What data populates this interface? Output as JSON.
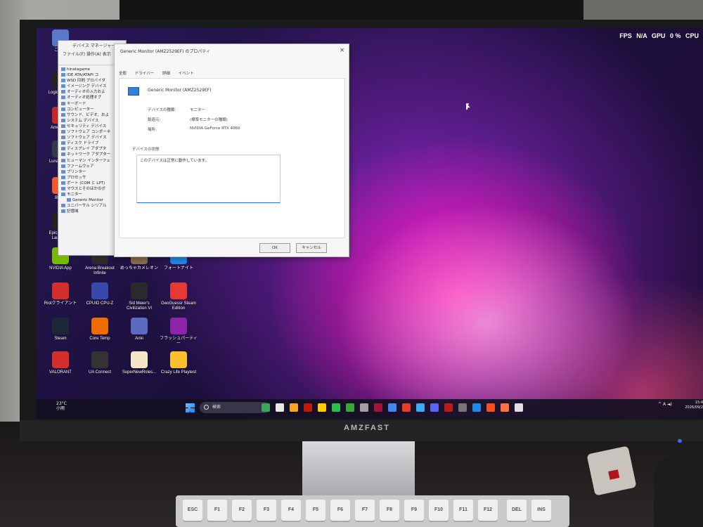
{
  "monitor": {
    "brand": "AMZFAST"
  },
  "overlay": {
    "fps_label": "FPS",
    "fps_value": "N/A",
    "gpu_label": "GPU",
    "gpu_value": "0 %",
    "cpu_label": "CPU"
  },
  "desktop_icons": [
    {
      "label": "ごみ箱",
      "icon": "recycle-bin-icon",
      "color": "#5a78c8"
    },
    {
      "label": "Logicool G H",
      "icon": "logitech-g-icon",
      "color": "#222222"
    },
    {
      "label": "Among Us",
      "icon": "among-us-icon",
      "color": "#c62828"
    },
    {
      "label": "Lunar Client",
      "icon": "lunar-client-icon",
      "color": "#333a48"
    },
    {
      "label": "Brave",
      "icon": "brave-icon",
      "color": "#f15a29"
    },
    {
      "label": "Epic Games Launcher",
      "icon": "epic-games-icon",
      "color": "#222222"
    },
    {
      "label": "NVIDIA App",
      "icon": "nvidia-icon",
      "color": "#76b900"
    },
    {
      "label": "Arena Breakout Infinite",
      "icon": "abi-icon",
      "color": "#2b2b2b"
    },
    {
      "label": "めっちゃカメレオン",
      "icon": "chameleon-icon",
      "color": "#8a6b4a"
    },
    {
      "label": "フォートナイト",
      "icon": "fortnite-icon",
      "color": "#1e88e5"
    },
    {
      "label": "Riotクライアント",
      "icon": "riot-icon",
      "color": "#d32f2f"
    },
    {
      "label": "CPUID CPU-Z",
      "icon": "cpuz-icon",
      "color": "#3949ab"
    },
    {
      "label": "Sid Meier's Civilization VI",
      "icon": "civ6-icon",
      "color": "#2a2a2a"
    },
    {
      "label": "GeoGuessr Steam Edition",
      "icon": "geoguessr-icon",
      "color": "#e53935"
    },
    {
      "label": "Steam",
      "icon": "steam-icon",
      "color": "#1b2838"
    },
    {
      "label": "Core Temp",
      "icon": "core-temp-icon",
      "color": "#ef6c00"
    },
    {
      "label": "Anki",
      "icon": "anki-icon",
      "color": "#5c6bc0"
    },
    {
      "label": "フラッシュパーティー",
      "icon": "flash-party-icon",
      "color": "#8e24aa"
    },
    {
      "label": "VALORANT",
      "icon": "valorant-icon",
      "color": "#d32f2f"
    },
    {
      "label": "UA Connect",
      "icon": "ua-connect-icon",
      "color": "#333333"
    },
    {
      "label": "SuperNewRoles...",
      "icon": "supernewroles-icon",
      "color": "#f5e6c8"
    },
    {
      "label": "Crazy Life Playtest",
      "icon": "crazy-life-icon",
      "color": "#fbc02d"
    }
  ],
  "device_manager": {
    "title": "デバイス マネージャー",
    "menu": "ファイル(F)  操作(A)  表示",
    "tree": [
      "hinatagame",
      "IDE ATA/ATAPI コ",
      "WSD 印刷 プロバイダ",
      "イメージング デバイス",
      "オーディオの入力およ",
      "オーディオ処理オブ",
      "キーボード",
      "コンピューター",
      "サウンド、ビデオ、およ",
      "システム デバイス",
      "セキュリティ デバイス",
      "ソフトウェア コンポーネ",
      "ソフトウェア デバイス",
      "ディスク ドライブ",
      "ディスプレイ アダプタ",
      "ネットワーク アダプター",
      "ヒューマン インターフェ",
      "ファームウェア",
      "プリンター",
      "プロセッサ",
      "ポート (COM と LPT)",
      "マウスとそのほかのポ",
      "モニター",
      "Generic Monitor",
      "ユニバーサル シリアル",
      "記憶域"
    ]
  },
  "properties": {
    "title": "Generic Monitor (AMZ2529EF) のプロパティ",
    "tabs": [
      "全般",
      "ドライバー",
      "詳細",
      "イベント"
    ],
    "device_name": "Generic Monitor (AMZ2529EF)",
    "rows": [
      {
        "label": "デバイスの種類:",
        "value": "モニター"
      },
      {
        "label": "製造元:",
        "value": "(標準モニターの種類)"
      },
      {
        "label": "場所:",
        "value": "NVIDIA GeForce RTX 4060"
      }
    ],
    "status_group": "デバイスの状態",
    "status_text": "このデバイスは正常に動作しています。",
    "ok_label": "OK",
    "cancel_label": "キャンセル"
  },
  "taskbar": {
    "weather_temp": "23°C",
    "weather_desc": "小雨",
    "search_placeholder": "検索",
    "app_colors": [
      "#3ba55c",
      "#e8e8e8",
      "#f5a623",
      "#c21807",
      "#ffcc00",
      "#2bbd4e",
      "#38a838",
      "#a0a0a0",
      "#a4143a",
      "#4285f4",
      "#e33e2b",
      "#3fa9f5",
      "#5865f2",
      "#b71c1c",
      "#777777",
      "#1e88e5",
      "#f4511e",
      "#ff7043",
      "#e0e0e0"
    ],
    "ime": "A",
    "clock_time": "15:4",
    "clock_date": "2026/09/2"
  },
  "keyboard": {
    "keys": [
      "ESC",
      "F1",
      "F2",
      "F3",
      "F4",
      "F5",
      "F6",
      "F7",
      "F8",
      "F9",
      "F10",
      "F11",
      "F12",
      "DEL",
      "INS"
    ]
  }
}
